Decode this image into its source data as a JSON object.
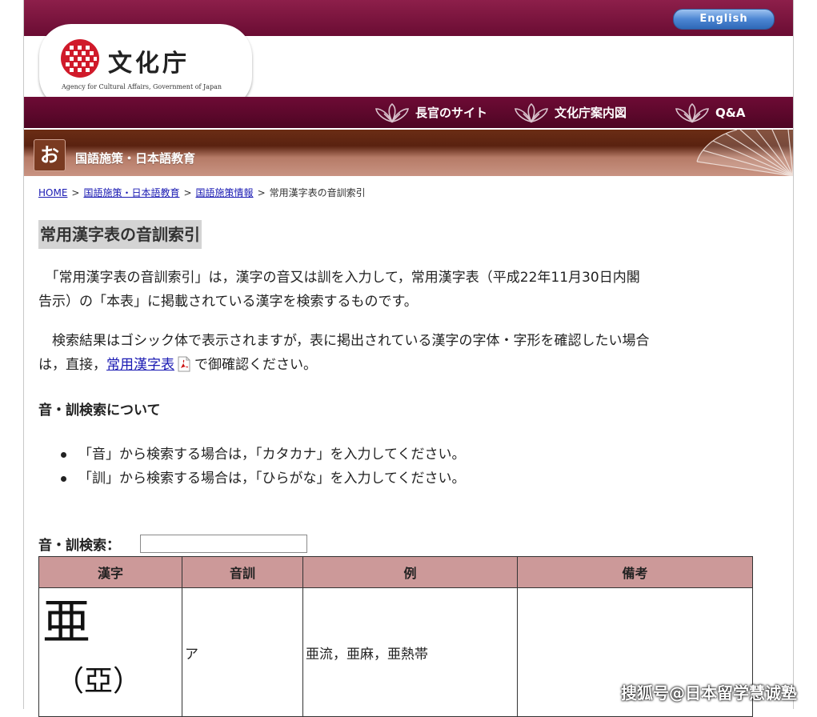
{
  "header": {
    "lang_button": "English",
    "logo_text": "文化庁",
    "logo_subtitle": "Agency for Cultural Affairs, Government of Japan",
    "nav": [
      {
        "label": "長官のサイト"
      },
      {
        "label": "文化庁案内図"
      },
      {
        "label": "Q&A"
      }
    ],
    "section_icon": "お",
    "section_title": "国語施策・日本語教育",
    "colors": {
      "brand": "#6a0c33",
      "section": "#5a2210",
      "button": "#3f78c8"
    }
  },
  "breadcrumb": {
    "items": [
      {
        "label": "HOME"
      },
      {
        "label": "国語施策・日本語教育"
      },
      {
        "label": "国語施策情報"
      }
    ],
    "current": "常用漢字表の音訓索引",
    "separator": ">"
  },
  "page": {
    "title": "常用漢字表の音訓索引",
    "intro_line1": "　「常用漢字表の音訓索引」は，漢字の音又は訓を入力して，常用漢字表（平成22年11月30日内閣",
    "intro_line2": "告示）の「本表」に掲載されている漢字を検索するものです。",
    "note_line1": "　検索結果はゴシック体で表示されますが，表に掲出されている漢字の字体・字形を確認したい場合",
    "note_prefix": "は，直接，",
    "note_link": "常用漢字表",
    "note_suffix": "で御確認ください。",
    "pdf_icon": "pdf-icon"
  },
  "search_help": {
    "heading": "音・訓検索について",
    "bullets": [
      "「音」から検索する場合は，「カタカナ」を入力してください。",
      "「訓」から検索する場合は，「ひらがな」を入力してください。"
    ]
  },
  "search": {
    "label": "音・訓検索：",
    "value": "",
    "placeholder": ""
  },
  "table": {
    "headers": [
      "漢字",
      "音訓",
      "例",
      "備考"
    ],
    "rows": [
      {
        "kanji": "亜",
        "old_form": "（亞）",
        "reading": "ア",
        "examples": "亜流，亜麻，亜熱帯",
        "remarks": ""
      }
    ],
    "header_color": "#cc9999"
  },
  "watermark": "搜狐号@日本留学慧诚塾"
}
